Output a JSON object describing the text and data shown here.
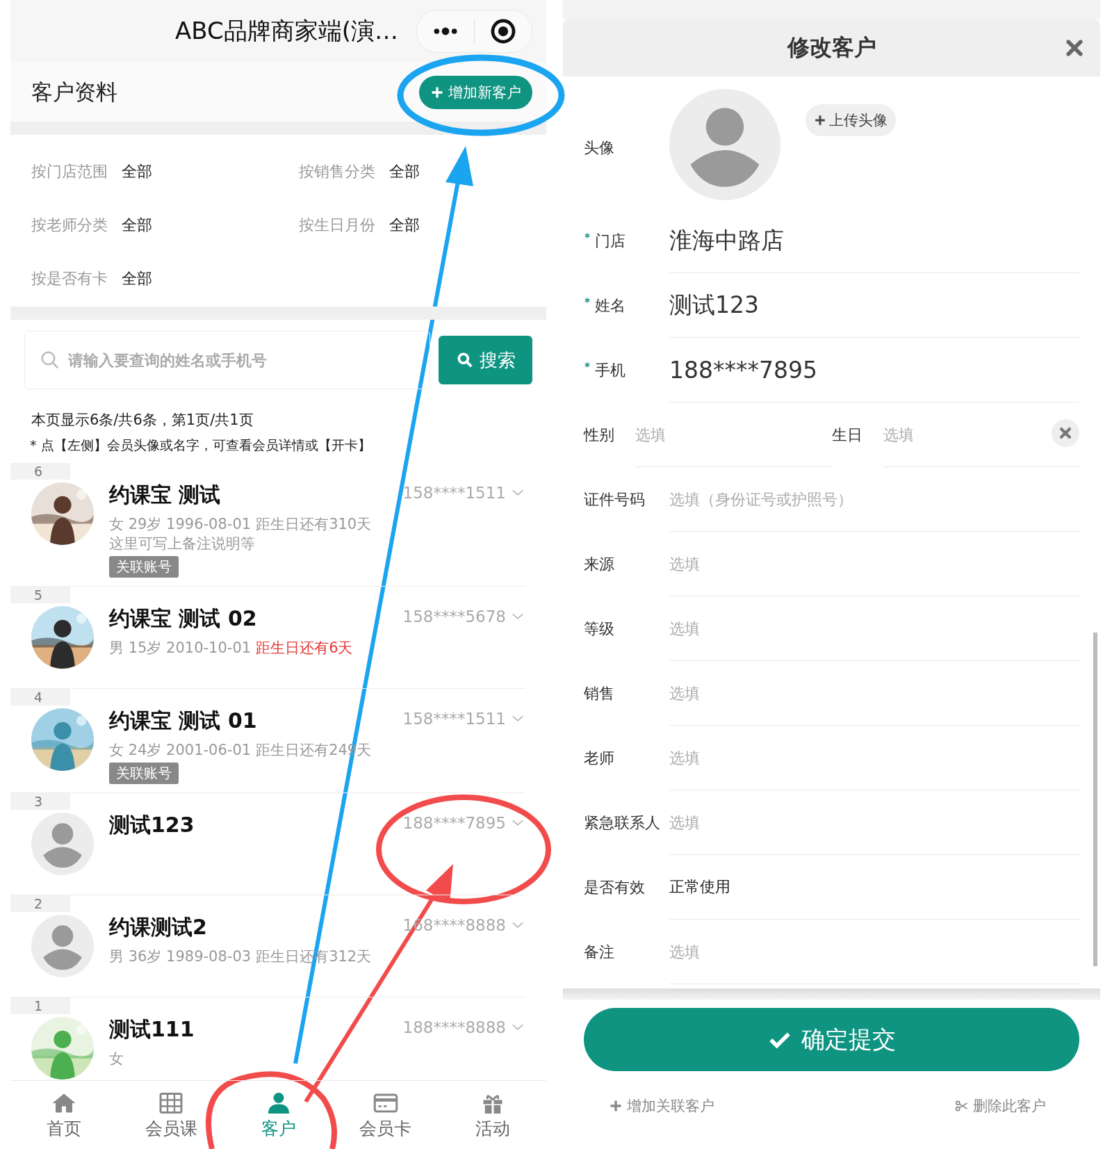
{
  "app_bar": {
    "title": "ABC品牌商家端(演…"
  },
  "page_header": {
    "title": "客户资料",
    "add_button": "增加新客户"
  },
  "filters": [
    {
      "label": "按门店范围",
      "value": "全部"
    },
    {
      "label": "按销售分类",
      "value": "全部"
    },
    {
      "label": "按老师分类",
      "value": "全部"
    },
    {
      "label": "按生日月份",
      "value": "全部"
    },
    {
      "label": "按是否有卡",
      "value": "全部"
    }
  ],
  "search": {
    "placeholder": "请输入要查询的姓名或手机号",
    "button": "搜索"
  },
  "summary": "本页显示6条/共6条，第1页/共1页",
  "hint": "* 点【左侧】会员头像或名字，可查看会员详情或【开卡】",
  "customers": [
    {
      "index": "6",
      "kind": "picture",
      "name": "约课宝 测试",
      "phone": "158****1511",
      "info": "女 29岁 1996-08-01",
      "birthday": "距生日还有310天",
      "birthday_soon": false,
      "note": "这里可写上备注说明等",
      "tag": "关联账号"
    },
    {
      "index": "5",
      "kind": "picture",
      "name": "约课宝 测试 02",
      "phone": "158****5678",
      "info": "男 15岁 2010-10-01",
      "birthday": "距生日还有6天",
      "birthday_soon": true
    },
    {
      "index": "4",
      "kind": "picture",
      "name": "约课宝 测试 01",
      "phone": "158****1511",
      "info": "女 24岁 2001-06-01",
      "birthday": "距生日还有249天",
      "birthday_soon": false,
      "tag": "关联账号"
    },
    {
      "index": "3",
      "kind": "default",
      "name": "测试123",
      "phone": "188****7895"
    },
    {
      "index": "2",
      "kind": "default",
      "name": "约课测试2",
      "phone": "168****8888",
      "info": "男 36岁 1989-08-03",
      "birthday": "距生日还有312天",
      "birthday_soon": false
    },
    {
      "index": "1",
      "kind": "picture",
      "name": "测试111",
      "phone": "188****8888",
      "info": "女"
    }
  ],
  "tabs": [
    {
      "label": "首页",
      "selected": false
    },
    {
      "label": "会员课",
      "selected": false
    },
    {
      "label": "客户",
      "selected": true
    },
    {
      "label": "会员卡",
      "selected": false
    },
    {
      "label": "活动",
      "selected": false
    }
  ],
  "dialog": {
    "title": "修改客户",
    "avatar_label": "头像",
    "upload_button": "上传头像",
    "fields": [
      {
        "kind": "value",
        "label": "门店",
        "required": true,
        "value": "淮海中路店"
      },
      {
        "kind": "value",
        "label": "姓名",
        "required": true,
        "value": "测试123"
      },
      {
        "kind": "value",
        "label": "手机",
        "required": true,
        "value": "188****7895"
      },
      {
        "kind": "pair",
        "items": [
          {
            "label": "性别",
            "placeholder": "选填"
          },
          {
            "label": "生日",
            "placeholder": "选填"
          }
        ]
      },
      {
        "kind": "placeholder",
        "label": "证件号码",
        "required": false,
        "placeholder": "选填（身份证号或护照号）"
      },
      {
        "kind": "placeholder",
        "label": "来源",
        "required": false,
        "placeholder": "选填"
      },
      {
        "kind": "placeholder",
        "label": "等级",
        "required": false,
        "placeholder": "选填"
      },
      {
        "kind": "placeholder",
        "label": "销售",
        "required": false,
        "placeholder": "选填"
      },
      {
        "kind": "placeholder",
        "label": "老师",
        "required": false,
        "placeholder": "选填"
      },
      {
        "kind": "placeholder",
        "label": "紧急联系人",
        "required": false,
        "placeholder": "选填"
      },
      {
        "kind": "text",
        "label": "是否有效",
        "required": false,
        "value": "正常使用"
      },
      {
        "kind": "placeholder",
        "label": "备注",
        "required": false,
        "placeholder": "选填"
      }
    ],
    "submit_button": "确定提交",
    "add_related_link": "增加关联客户",
    "delete_link": "删除此客户"
  }
}
